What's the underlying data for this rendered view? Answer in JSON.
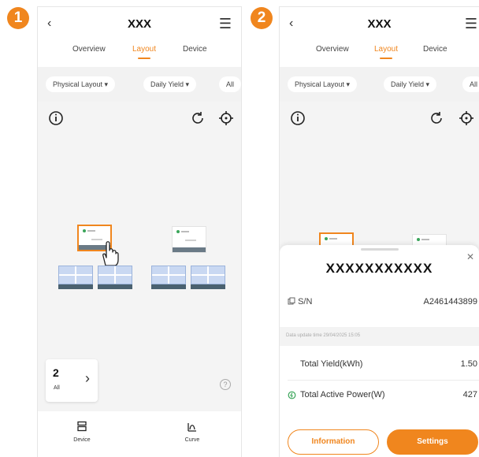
{
  "steps": [
    "1",
    "2"
  ],
  "screen1": {
    "header": {
      "back_icon": "chevron-left-icon",
      "title": "XXX",
      "menu_icon": "hamburger-menu-icon"
    },
    "tabs": [
      "Overview",
      "Layout",
      "Device"
    ],
    "active_tab": "Layout",
    "filters": [
      "Physical Layout",
      "Daily Yield",
      "All"
    ],
    "canvas_icons": [
      "info-icon",
      "refresh-icon",
      "locate-icon"
    ],
    "summary": {
      "count": "2",
      "label": "All"
    },
    "bottom_nav": [
      {
        "label": "Device",
        "icon": "device-icon"
      },
      {
        "label": "Curve",
        "icon": "curve-icon"
      }
    ]
  },
  "screen2": {
    "header": {
      "back_icon": "chevron-left-icon",
      "title": "XXX",
      "menu_icon": "hamburger-menu-icon"
    },
    "tabs": [
      "Overview",
      "Layout",
      "Device"
    ],
    "active_tab": "Layout",
    "filters": [
      "Physical Layout",
      "Daily Yield",
      "All"
    ],
    "sheet": {
      "title": "XXXXXXXXXXX",
      "sn_label": "S/N",
      "sn_value": "A2461443899",
      "update_text": "Data update time 29/04/2025 15:05",
      "total_yield_label": "Total Yield(kWh)",
      "total_yield_value": "1.50",
      "active_power_label": "Total Active Power(W)",
      "active_power_value": "427",
      "information_button": "Information",
      "settings_button": "Settings"
    }
  },
  "colors": {
    "accent": "#f0861e",
    "panel_blue": "#c9d8f2",
    "inverter_green": "#3aa55a"
  }
}
